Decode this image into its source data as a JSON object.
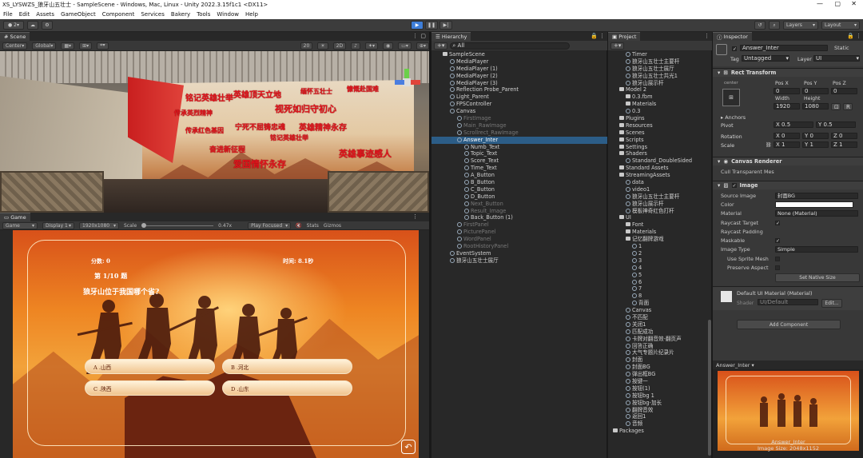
{
  "window": {
    "title": "XS_LYSWZS_狼牙山五壮士 - SampleScene - Windows, Mac, Linux - Unity 2022.3.15f1c1 <DX11>"
  },
  "menu": [
    "File",
    "Edit",
    "Assets",
    "GameObject",
    "Component",
    "Services",
    "Bakery",
    "Tools",
    "Window",
    "Help"
  ],
  "toolbar": {
    "account": "2",
    "layers": "Layers",
    "layout": "Layout"
  },
  "scene": {
    "tab": "Scene",
    "pivot": "Center",
    "space": "Global",
    "snap": "20",
    "mode": "2D",
    "slogans": [
      "铭记英雄壮举",
      "英雄顶天立地",
      "缅怀五壮士",
      "慷慨赴国难",
      "传承英烈精神",
      "视死如归守初心",
      "宁死不屈铸忠魂",
      "英雄精神永存",
      "传承红色基因",
      "铭记英雄壮举",
      "奋进新征程",
      "英雄事迹感人",
      "爱国情怀永存"
    ]
  },
  "game": {
    "tab": "Game",
    "display": "Game",
    "display_num": "Display 1",
    "resolution": "1920x1080",
    "scale_label": "Scale",
    "scale_value": "0.47x",
    "play_focused": "Play Focused",
    "stats": "Stats",
    "gizmos": "Gizmos",
    "score": "分数: 0",
    "time": "时间: 8.1秒",
    "question_num": "第 1/10 题",
    "question": "狼牙山位于我国哪个省?",
    "answers": [
      "A .山西",
      "B .河北",
      "C .陕西",
      "D .山东"
    ]
  },
  "hierarchy": {
    "tab": "Hierarchy",
    "search": "All",
    "items": [
      {
        "label": "SampleScene",
        "depth": 0
      },
      {
        "label": "MediaPlayer",
        "depth": 1
      },
      {
        "label": "MediaPlayer (1)",
        "depth": 1
      },
      {
        "label": "MediaPlayer (2)",
        "depth": 1
      },
      {
        "label": "MediaPlayer (3)",
        "depth": 1
      },
      {
        "label": "Reflection Probe_Parent",
        "depth": 1
      },
      {
        "label": "Light_Parent",
        "depth": 1
      },
      {
        "label": "FPSController",
        "depth": 1
      },
      {
        "label": "Canvas",
        "depth": 1
      },
      {
        "label": "FirstImage",
        "depth": 2,
        "dim": true
      },
      {
        "label": "Main_RawImage",
        "depth": 2,
        "dim": true
      },
      {
        "label": "Scrollrect_RawImage",
        "depth": 2,
        "dim": true
      },
      {
        "label": "Answer_Inter",
        "depth": 2,
        "sel": true
      },
      {
        "label": "Numb_Text",
        "depth": 3
      },
      {
        "label": "Topic_Text",
        "depth": 3
      },
      {
        "label": "Score_Text",
        "depth": 3
      },
      {
        "label": "Time_Text",
        "depth": 3
      },
      {
        "label": "A_Button",
        "depth": 3
      },
      {
        "label": "B_Button",
        "depth": 3
      },
      {
        "label": "C_Button",
        "depth": 3
      },
      {
        "label": "D_Button",
        "depth": 3
      },
      {
        "label": "Next_Button",
        "depth": 3,
        "dim": true
      },
      {
        "label": "Result_Image",
        "depth": 3,
        "dim": true
      },
      {
        "label": "Back_Button (1)",
        "depth": 3
      },
      {
        "label": "FirstPanel",
        "depth": 2,
        "dim": true
      },
      {
        "label": "PicturePanel",
        "depth": 2,
        "dim": true
      },
      {
        "label": "WordPanel",
        "depth": 2,
        "dim": true
      },
      {
        "label": "RootHistoryPanel",
        "depth": 2,
        "dim": true
      },
      {
        "label": "EventSystem",
        "depth": 1
      },
      {
        "label": "狼牙山五壮士展厅",
        "depth": 1
      }
    ]
  },
  "project": {
    "tab": "Project",
    "items": [
      {
        "label": "Timer",
        "depth": 2
      },
      {
        "label": "狼牙山五壮士主要杆",
        "depth": 2
      },
      {
        "label": "狼牙山五壮士展厅",
        "depth": 2
      },
      {
        "label": "狼牙山五壮士共光1",
        "depth": 2
      },
      {
        "label": "狼牙山展示杆",
        "depth": 2
      },
      {
        "label": "Model 2",
        "depth": 1,
        "folder": true
      },
      {
        "label": "0.3.fbm",
        "depth": 2,
        "folder": true
      },
      {
        "label": "Materials",
        "depth": 2,
        "folder": true
      },
      {
        "label": "0.3",
        "depth": 2
      },
      {
        "label": "Plugins",
        "depth": 1,
        "folder": true
      },
      {
        "label": "Resources",
        "depth": 1,
        "folder": true
      },
      {
        "label": "Scenes",
        "depth": 1,
        "folder": true
      },
      {
        "label": "Scripts",
        "depth": 1,
        "folder": true
      },
      {
        "label": "Settings",
        "depth": 1,
        "folder": true
      },
      {
        "label": "Shaders",
        "depth": 1,
        "folder": true
      },
      {
        "label": "Standard_DoubleSided",
        "depth": 2
      },
      {
        "label": "Standard Assets",
        "depth": 1,
        "folder": true
      },
      {
        "label": "StreamingAssets",
        "depth": 1,
        "folder": true
      },
      {
        "label": "data",
        "depth": 2
      },
      {
        "label": "video1",
        "depth": 2
      },
      {
        "label": "狼牙山五壮士主要杆",
        "depth": 2
      },
      {
        "label": "狼牙山展示杆",
        "depth": 2
      },
      {
        "label": "模板神奇红色打杆",
        "depth": 2
      },
      {
        "label": "UI",
        "depth": 1,
        "folder": true
      },
      {
        "label": "Font",
        "depth": 2,
        "folder": true
      },
      {
        "label": "Materials",
        "depth": 2,
        "folder": true
      },
      {
        "label": "记忆翻牌游戏",
        "depth": 2,
        "folder": true
      },
      {
        "label": "1",
        "depth": 3
      },
      {
        "label": "2",
        "depth": 3
      },
      {
        "label": "3",
        "depth": 3
      },
      {
        "label": "4",
        "depth": 3
      },
      {
        "label": "5",
        "depth": 3
      },
      {
        "label": "6",
        "depth": 3
      },
      {
        "label": "7",
        "depth": 3
      },
      {
        "label": "8",
        "depth": 3
      },
      {
        "label": "背面",
        "depth": 3
      },
      {
        "label": "Canvas",
        "depth": 2
      },
      {
        "label": "不匹配",
        "depth": 2
      },
      {
        "label": "关闭1",
        "depth": 2
      },
      {
        "label": "匹配成功",
        "depth": 2
      },
      {
        "label": "卡牌对翻音效-翻页声",
        "depth": 2
      },
      {
        "label": "回答正确",
        "depth": 2
      },
      {
        "label": "大气专题片纪录片",
        "depth": 2
      },
      {
        "label": "封面",
        "depth": 2
      },
      {
        "label": "封面BG",
        "depth": 2
      },
      {
        "label": "弹出框BG",
        "depth": 2
      },
      {
        "label": "按键一",
        "depth": 2
      },
      {
        "label": "按钮(1)",
        "depth": 2
      },
      {
        "label": "按钮bg 1",
        "depth": 2
      },
      {
        "label": "按钮bg-加长",
        "depth": 2
      },
      {
        "label": "翻牌音效",
        "depth": 2
      },
      {
        "label": "返回1",
        "depth": 2
      },
      {
        "label": "音频",
        "depth": 2
      },
      {
        "label": "Packages",
        "depth": 0,
        "folder": true
      }
    ]
  },
  "inspector": {
    "tab": "Inspector",
    "object_name": "Answer_Inter",
    "static": "Static",
    "tag_label": "Tag",
    "tag": "Untagged",
    "layer_label": "Layer",
    "layer": "UI",
    "rect": {
      "title": "Rect Transform",
      "anchor_preset": "center",
      "pos_labels": [
        "Pos X",
        "Pos Y",
        "Pos Z"
      ],
      "pos": [
        "0",
        "0",
        "0"
      ],
      "size_labels": [
        "Width",
        "Height"
      ],
      "size": [
        "1920",
        "1080"
      ],
      "anchors": "Anchors",
      "pivot_label": "Pivot",
      "pivot": [
        "X 0.5",
        "Y 0.5"
      ],
      "rotation_label": "Rotation",
      "rotation": [
        "X 0",
        "Y 0",
        "Z 0"
      ],
      "scale_label": "Scale",
      "scale": [
        "X 1",
        "Y 1",
        "Z 1"
      ]
    },
    "canvas_renderer": {
      "title": "Canvas Renderer",
      "cull": "Cull Transparent Mes"
    },
    "image": {
      "title": "Image",
      "rows": [
        {
          "label": "Source Image",
          "value": "封面BG"
        },
        {
          "label": "Color",
          "value": ""
        },
        {
          "label": "Material",
          "value": "None (Material)"
        },
        {
          "label": "Raycast Target",
          "value": "✓"
        },
        {
          "label": "Raycast Padding",
          "value": ""
        },
        {
          "label": "Maskable",
          "value": "✓"
        },
        {
          "label": "Image Type",
          "value": "Simple"
        },
        {
          "label": "Use Sprite Mesh",
          "value": ""
        },
        {
          "label": "Preserve Aspect",
          "value": ""
        }
      ],
      "native_size": "Set Native Size"
    },
    "material": {
      "title": "Default UI Material (Material)",
      "shader_label": "Shader",
      "shader": "UI/Default",
      "edit": "Edit..."
    },
    "add_component": "Add Component",
    "preview": {
      "name": "Answer_Inter",
      "caption": "Answer_Inter",
      "size": "Image Size: 2048x1152"
    }
  }
}
